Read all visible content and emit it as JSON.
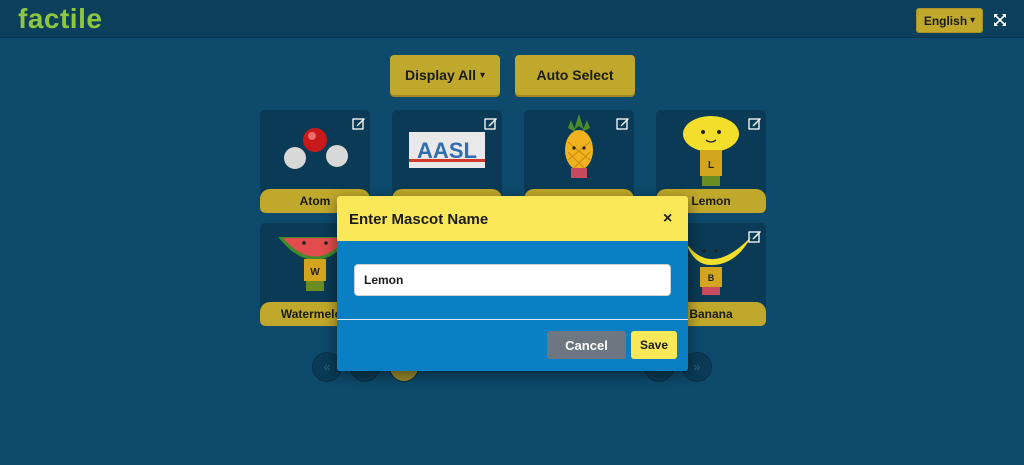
{
  "app": {
    "logo": "factile"
  },
  "header": {
    "language": "English",
    "chevron": "▾"
  },
  "controls": {
    "display_all": "Display All",
    "auto_select": "Auto Select"
  },
  "mascots": [
    {
      "name": "Atom",
      "icon": "atom-molecule"
    },
    {
      "name": "AASL",
      "icon": "aasl-logo",
      "logo_text": "AASL"
    },
    {
      "name": "",
      "icon": "pineapple-mascot"
    },
    {
      "name": "Lemon",
      "icon": "lemon-mascot",
      "badge": "L"
    },
    {
      "name": "Watermelon",
      "icon": "watermelon-mascot",
      "badge": "W"
    },
    {
      "name": "Banana",
      "icon": "banana-mascot",
      "badge": "B"
    }
  ],
  "pagination": {
    "first": "«",
    "last": "»"
  },
  "modal": {
    "title": "Enter Mascot Name",
    "close": "×",
    "input_value": "Lemon",
    "cancel": "Cancel",
    "save": "Save"
  },
  "colors": {
    "background": "#0d4a6b",
    "gold_button": "#bfa82b",
    "modal_body": "#0a7fc4",
    "modal_header": "#fbe858",
    "logo_green": "#8fc63f"
  }
}
